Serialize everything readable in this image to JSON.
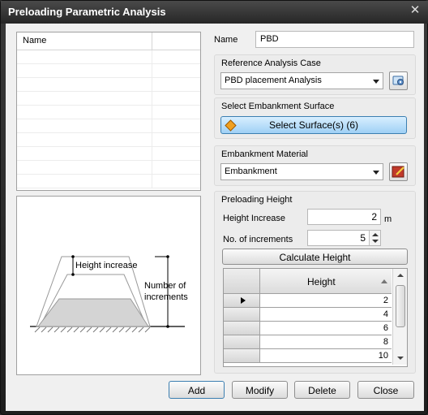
{
  "window": {
    "title": "Preloading Parametric Analysis",
    "close_glyph": "✕"
  },
  "list": {
    "column_header": "Name",
    "row_count": 10
  },
  "diagram": {
    "height_increase_label": "Height increase",
    "number_of_increments_label": "Number of\nincrements"
  },
  "name_field": {
    "label": "Name",
    "value": "PBD"
  },
  "reference_case": {
    "group_label": "Reference Analysis Case",
    "selected": "PBD placement Analysis"
  },
  "embankment_surface": {
    "group_label": "Select Embankment Surface",
    "button_label": "Select Surface(s) (6)"
  },
  "embankment_material": {
    "group_label": "Embankment Material",
    "selected": "Embankment"
  },
  "preloading_height": {
    "group_label": "Preloading Height",
    "height_increase_label": "Height Increase",
    "height_increase_value": "2",
    "height_increase_unit": "m",
    "increments_label": "No. of increments",
    "increments_value": "5",
    "calculate_button": "Calculate Height",
    "table_header": "Height",
    "table_values": [
      "2",
      "4",
      "6",
      "8",
      "10"
    ]
  },
  "buttons": {
    "add": "Add",
    "modify": "Modify",
    "delete": "Delete",
    "close": "Close"
  },
  "colors": {
    "accent_blue": "#9fd0f5",
    "surface_icon": "#f0a020",
    "material_icon": "#c0392b"
  }
}
